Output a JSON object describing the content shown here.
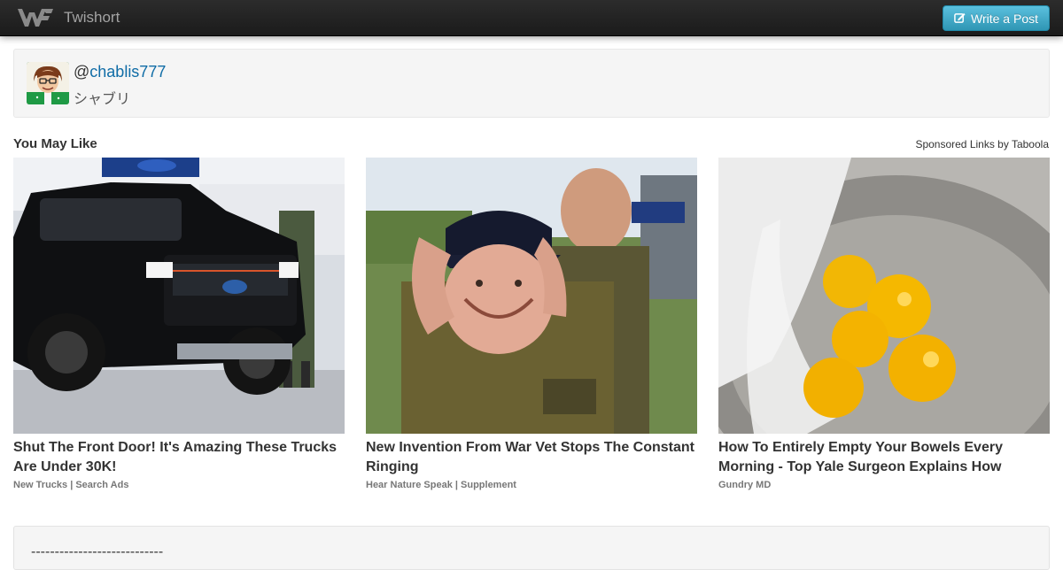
{
  "navbar": {
    "brand": "Twishort",
    "write_button": "Write a Post",
    "logo_icon": "twishort-logo-icon",
    "edit_icon": "edit-icon"
  },
  "profile": {
    "at": "@",
    "handle": "chablis777",
    "display_name": "シャブリ"
  },
  "recommendations": {
    "title": "You May Like",
    "sponsored": "Sponsored Links by Taboola",
    "items": [
      {
        "headline": "Shut The Front Door! It's Amazing These Trucks Are Under 30K!",
        "source": "New Trucks | Search Ads",
        "image": "black-pickup-truck-photo"
      },
      {
        "headline": "New Invention From War Vet Stops The Constant Ringing",
        "source": "Hear Nature Speak | Supplement",
        "image": "war-veteran-photo"
      },
      {
        "headline": "How To Entirely Empty Your Bowels Every Morning - Top Yale Surgeon Explains How",
        "source": "Gundry MD",
        "image": "egg-yolks-bowl-photo"
      }
    ]
  },
  "post": {
    "text": "----------------------------"
  },
  "colors": {
    "navbar": "#222222",
    "button": "#49afcd",
    "link": "#0f6ca6",
    "card_bg": "#f5f5f5"
  }
}
